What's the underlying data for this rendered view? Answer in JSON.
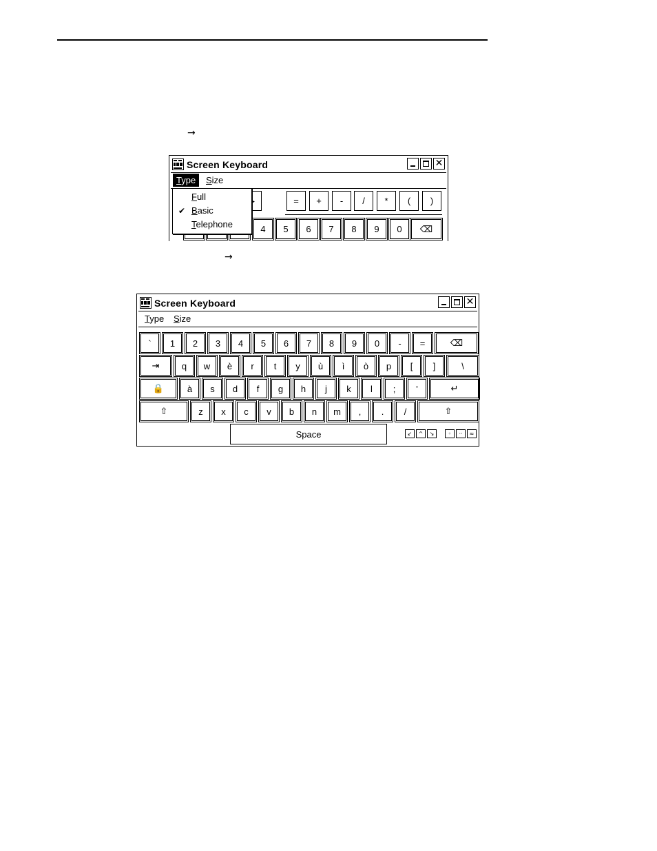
{
  "page": {
    "arrow1": "→",
    "arrow2": "→"
  },
  "window_small": {
    "title": "Screen Keyboard",
    "controls": [
      "minimize",
      "maximize",
      "close"
    ],
    "close_glyph": "✕",
    "menu": [
      {
        "label_ul": "T",
        "label_rest": "ype"
      },
      {
        "label_ul": "S",
        "label_rest": "ize"
      }
    ],
    "dropdown": [
      {
        "ul": "F",
        "rest": "ull",
        "checked": false
      },
      {
        "ul": "B",
        "rest": "asic",
        "checked": true
      },
      {
        "ul": "T",
        "rest": "elephone",
        "checked": false
      }
    ],
    "check_glyph": "✔",
    "row1_keys": [
      "▶",
      "=",
      "+",
      "-",
      "/",
      "*",
      "(",
      ")"
    ],
    "row2_keys": [
      "4",
      "5",
      "6",
      "7",
      "8",
      "9",
      "0",
      "⌫"
    ]
  },
  "window_full": {
    "title": "Screen Keyboard",
    "close_glyph": "✕",
    "menu": [
      {
        "label_ul": "T",
        "label_rest": "ype"
      },
      {
        "label_ul": "S",
        "label_rest": "ize"
      }
    ],
    "rows": [
      [
        "`",
        "1",
        "2",
        "3",
        "4",
        "5",
        "6",
        "7",
        "8",
        "9",
        "0",
        "-",
        "=",
        "⌫"
      ],
      [
        "⇥",
        "q",
        "w",
        "è",
        "r",
        "t",
        "y",
        "ù",
        "ì",
        "ò",
        "p",
        "[",
        "]",
        "\\"
      ],
      [
        "🔒",
        "à",
        "s",
        "d",
        "f",
        "g",
        "h",
        "j",
        "k",
        "l",
        ";",
        "'",
        "↵"
      ],
      [
        "⇧",
        "z",
        "x",
        "c",
        "v",
        "b",
        "n",
        "m",
        ",",
        ".",
        "/",
        "⇧"
      ]
    ],
    "space_label": "Space",
    "position_buttons": [
      "↙",
      "^",
      "↘"
    ],
    "size_buttons": [
      "◦",
      "··",
      "≈"
    ]
  }
}
